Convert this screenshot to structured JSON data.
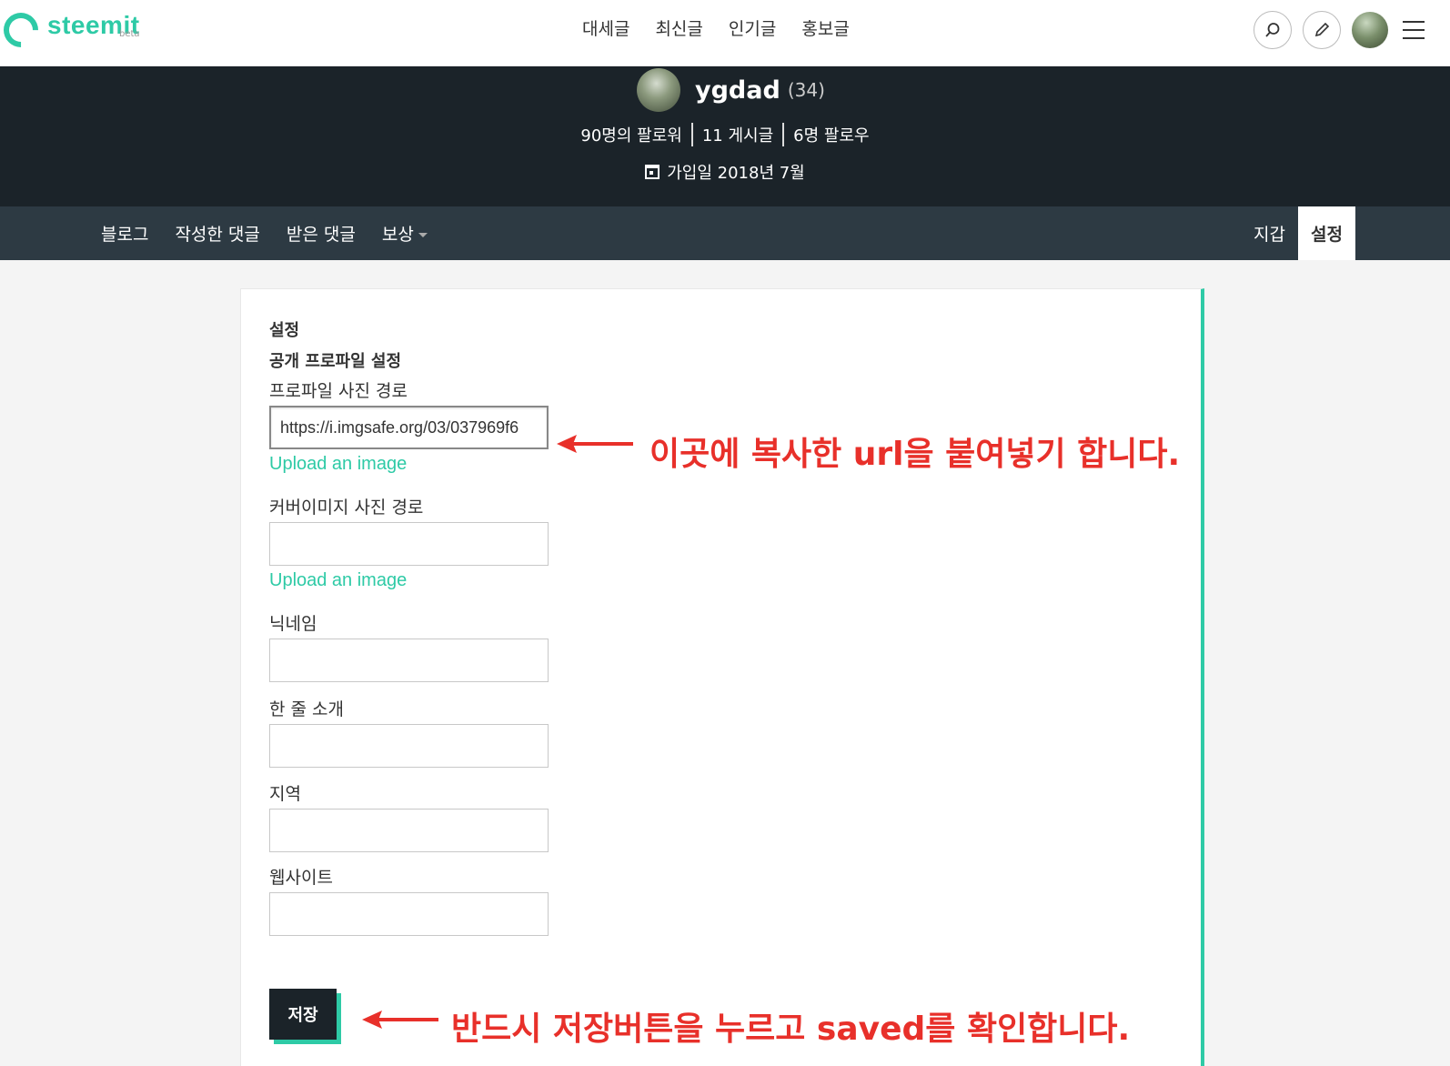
{
  "header": {
    "logo_text": "steemit",
    "logo_beta": "beta",
    "nav": [
      "대세글",
      "최신글",
      "인기글",
      "홍보글"
    ]
  },
  "profile": {
    "username": "ygdad",
    "reputation": "(34)",
    "followers": "90명의 팔로워",
    "posts": "11 게시글",
    "following": "6명 팔로우",
    "joined": "가입일 2018년 7월"
  },
  "subnav": {
    "blog": "블로그",
    "comments": "작성한 댓글",
    "replies": "받은 댓글",
    "rewards": "보상",
    "wallet": "지갑",
    "settings": "설정"
  },
  "settings": {
    "title": "설정",
    "section": "공개 프로파일 설정",
    "profile_image_label": "프로파일 사진 경로",
    "profile_image_value": "https://i.imgsafe.org/03/037969f6",
    "upload_1": "Upload an image",
    "cover_image_label": "커버이미지 사진 경로",
    "upload_2": "Upload an image",
    "nickname_label": "닉네임",
    "about_label": "한 줄 소개",
    "location_label": "지역",
    "website_label": "웹사이트",
    "save_label": "저장"
  },
  "annotations": {
    "paste_url": "이곳에 복사한 url을 붙여넣기 합니다.",
    "press_save": "반드시 저장버튼을 누르고 saved를 확인합니다."
  },
  "colors": {
    "accent": "#2ecaa6",
    "dark": "#1b2329",
    "subnav": "#2d3a43",
    "annotation": "#e8302a"
  }
}
